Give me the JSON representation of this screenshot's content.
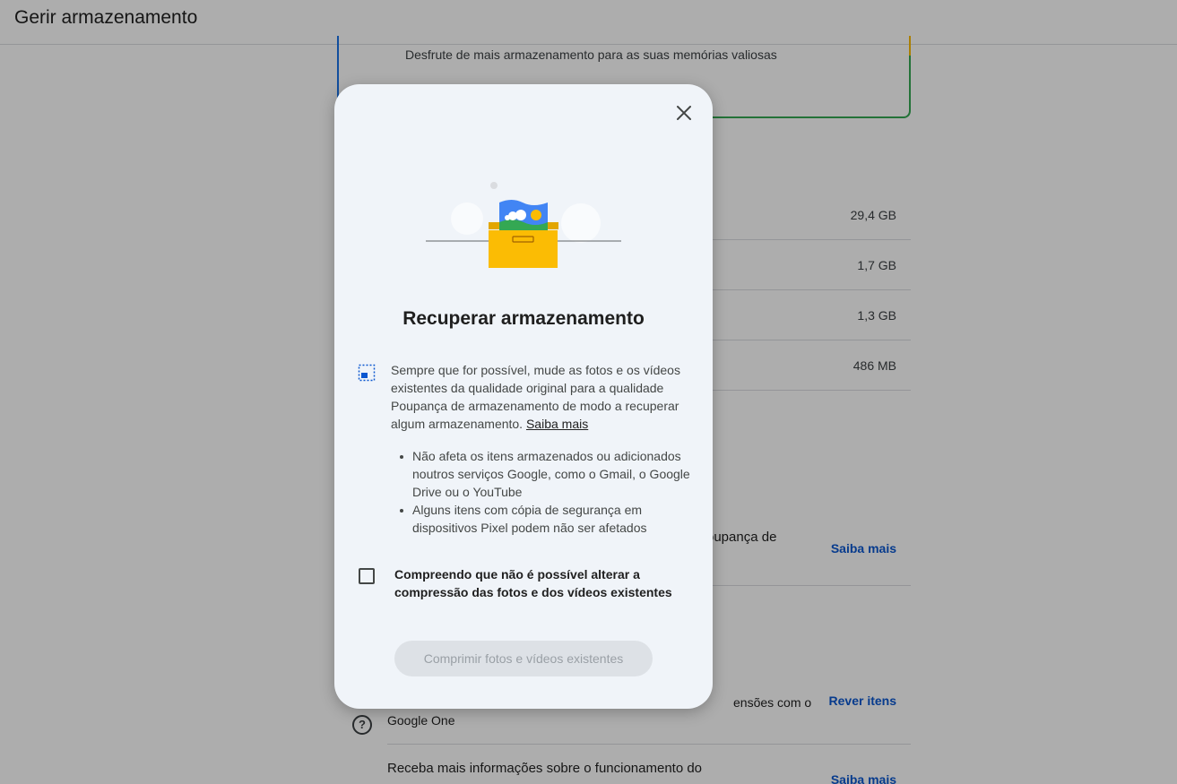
{
  "header": {
    "title": "Gerir armazenamento"
  },
  "upsell": {
    "text": "Desfrute de mais armazenamento para as suas memórias valiosas"
  },
  "usage": [
    {
      "size": "29,4 GB"
    },
    {
      "size": "1,7 GB"
    },
    {
      "size": "1,3 GB"
    },
    {
      "size": "486 MB"
    }
  ],
  "features": {
    "row1": {
      "text": "oupança de",
      "link": "Saiba mais"
    },
    "row2": {
      "text": "ensões com o",
      "text2": "Google One",
      "link": "Rever itens"
    },
    "row3": {
      "text": "Receba mais informações sobre o funcionamento do",
      "link": "Saiba mais"
    }
  },
  "dialog": {
    "title": "Recuperar armazenamento",
    "description": "Sempre que for possível, mude as fotos e os vídeos existentes da qualidade original para a qualidade Poupança de armazenamento de modo a recuperar algum armazenamento.",
    "description_link": "Saiba mais",
    "bullets": [
      "Não afeta os itens armazenados ou adicionados noutros serviços Google, como o Gmail, o Google Drive ou o YouTube",
      "Alguns itens com cópia de segurança em dispositivos Pixel podem não ser afetados"
    ],
    "checkbox_label": "Compreendo que não é possível alterar a compressão das fotos e dos vídeos existentes",
    "checkbox_checked": false,
    "button_label": "Comprimir fotos e vídeos existentes"
  },
  "icons": {
    "close": "close-icon",
    "compress": "photo-compress-icon",
    "help": "help-circle-icon",
    "illustration": "photo-box-illustration"
  },
  "colors": {
    "dialog_bg": "#f0f4f9",
    "link_blue": "#0b57d0",
    "box_yellow": "#fbbc04",
    "photo_blue": "#4285f4",
    "photo_green": "#34a853"
  }
}
